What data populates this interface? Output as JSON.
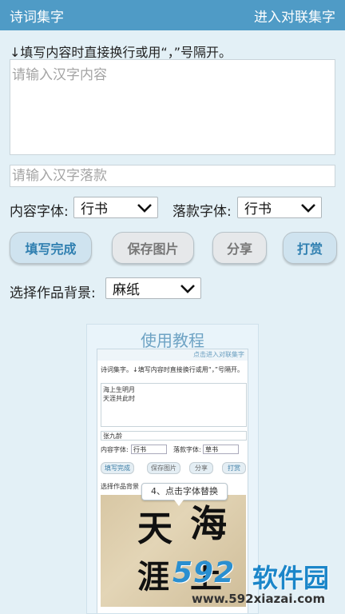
{
  "header": {
    "title": "诗词集字",
    "right_link": "进入对联集字"
  },
  "form": {
    "hint": "↓填写内容时直接换行或用“，”号隔开。",
    "content_placeholder": "请输入汉字内容",
    "signature_placeholder": "请输入汉字落款",
    "content_font_label": "内容字体:",
    "content_font_value": "行书",
    "sign_font_label": "落款字体:",
    "sign_font_value": "行书",
    "background_label": "选择作品背景:",
    "background_value": "麻纸"
  },
  "buttons": {
    "finish": "填写完成",
    "save": "保存图片",
    "share": "分享",
    "reward": "打赏"
  },
  "tutorial": {
    "title": "使用教程",
    "link": "点击进入对联集字",
    "hint": "诗词集字。↓填写内容时直接换行或用“，”号隔开。",
    "content_line1": "海上生明月",
    "content_line2": "天涯共此时",
    "signature": "张九龄",
    "content_font_label": "内容字体:",
    "content_font_value": "行书",
    "sign_font_label": "落款字体:",
    "sign_font_value": "草书",
    "btn_finish": "填写完成",
    "btn_save": "保存图片",
    "btn_share": "分享",
    "btn_reward": "打赏",
    "background_label": "选择作品背景",
    "callout": "4、点击字体替换",
    "calligraphy": [
      "天",
      "海",
      "涯",
      "上"
    ]
  },
  "watermark": {
    "logo": "592",
    "name": "软件园",
    "url": "www.592xiazai.com"
  },
  "colors": {
    "topbar": "#4f9bc6",
    "accent": "#2f7fb0",
    "background": "#e3f0f6"
  }
}
